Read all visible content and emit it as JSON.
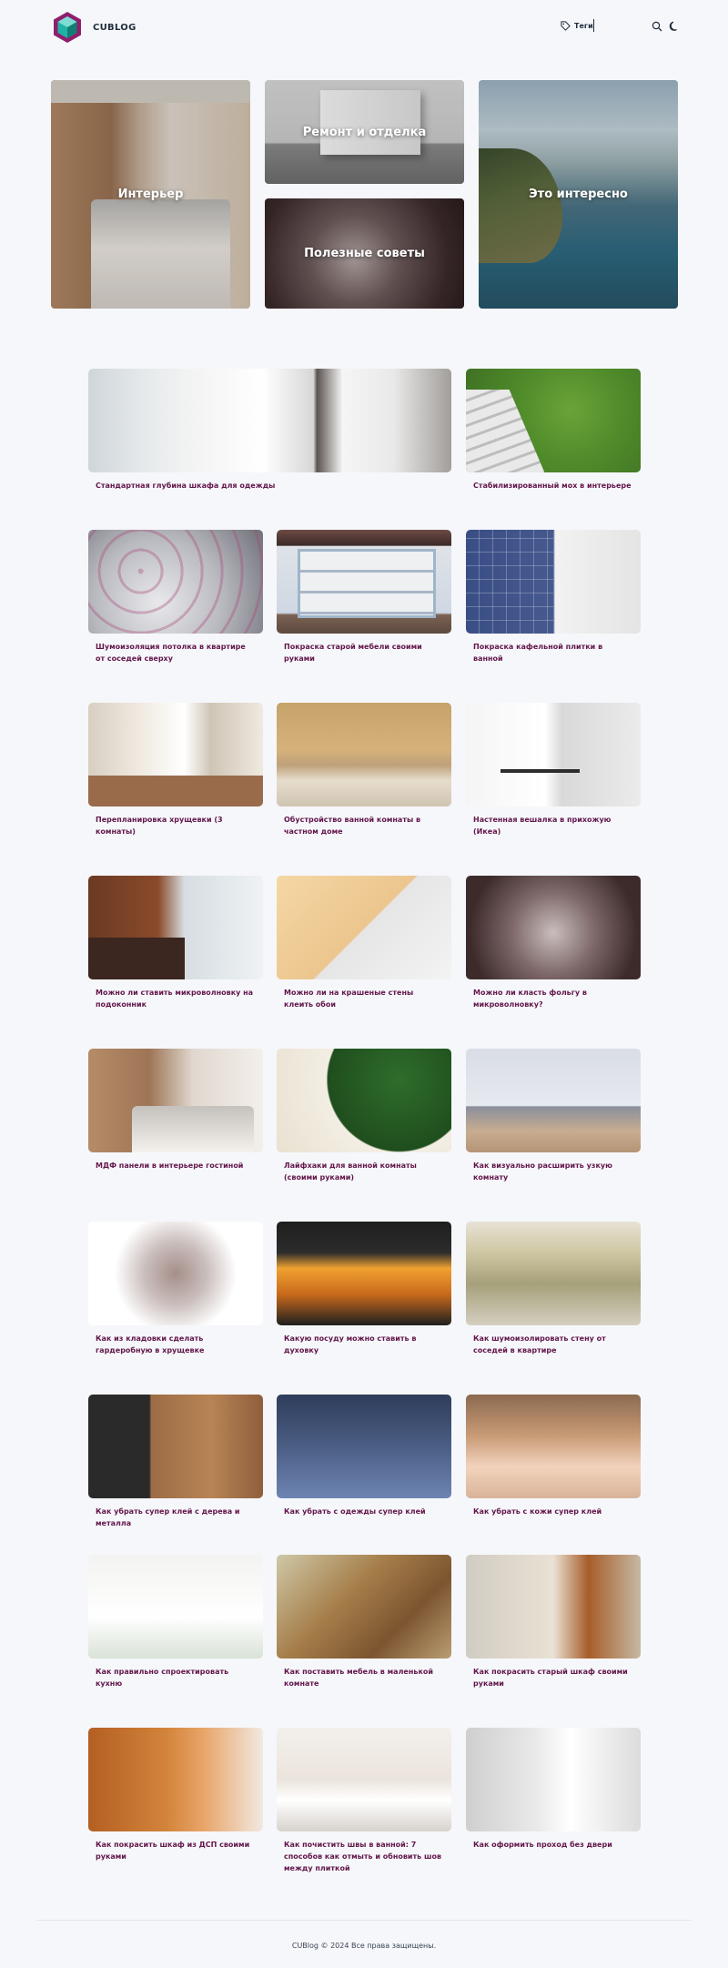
{
  "header": {
    "logo_text": "CUBLOG",
    "tags_label": "Теги",
    "icons": [
      "logo-cube-icon",
      "tag-icon",
      "search-icon",
      "moon-icon"
    ]
  },
  "hero": [
    {
      "label": "Интерьер"
    },
    {
      "label": "Ремонт и отделка"
    },
    {
      "label": "Полезные советы"
    },
    {
      "label": "Это интересно"
    }
  ],
  "posts": [
    {
      "title": "Стандартная глубина шкафа для одежды"
    },
    {
      "title": "Стабилизированный мох в интерьере"
    },
    {
      "title": "Шумоизоляция потолка в квартире от соседей сверху"
    },
    {
      "title": "Покраска старой мебели своими руками"
    },
    {
      "title": "Покраска кафельной плитки в ванной"
    },
    {
      "title": "Перепланировка хрущевки (3 комнаты)"
    },
    {
      "title": "Обустройство ванной комнаты в частном доме"
    },
    {
      "title": "Настенная вешалка в прихожую (Икеа)"
    },
    {
      "title": "Можно ли ставить микроволновку на подоконник"
    },
    {
      "title": "Можно ли на крашеные стены клеить обои"
    },
    {
      "title": "Можно ли класть фольгу в микроволновку?"
    },
    {
      "title": "МДФ панели в интерьере гостиной"
    },
    {
      "title": "Лайфхаки для ванной комнаты (своими руками)"
    },
    {
      "title": "Как визуально расширить узкую комнату"
    },
    {
      "title": "Как из кладовки сделать гардеробную в хрущевке"
    },
    {
      "title": "Какую посуду можно ставить в духовку"
    },
    {
      "title": "Как шумоизолировать стену от соседей в квартире"
    },
    {
      "title": "Как убрать супер клей с дерева и металла"
    },
    {
      "title": "Как убрать с одежды супер клей"
    },
    {
      "title": "Как убрать с кожи супер клей"
    },
    {
      "title": "Как правильно спроектировать кухню"
    },
    {
      "title": "Как поставить мебель в маленькой комнате"
    },
    {
      "title": "Как покрасить старый шкаф своими руками"
    },
    {
      "title": "Как покрасить шкаф из ДСП своими руками"
    },
    {
      "title": "Как почистить швы в ванной: 7 способов как отмыть и обновить шов между плиткой"
    },
    {
      "title": "Как оформить проход без двери"
    }
  ],
  "footer": {
    "text": "CUBlog © 2024 Все права защищены."
  },
  "colors": {
    "title": "#62164a",
    "logo_teal": "#1fb3a6",
    "logo_purple": "#8e1f6c",
    "background": "#f6f7fb"
  }
}
